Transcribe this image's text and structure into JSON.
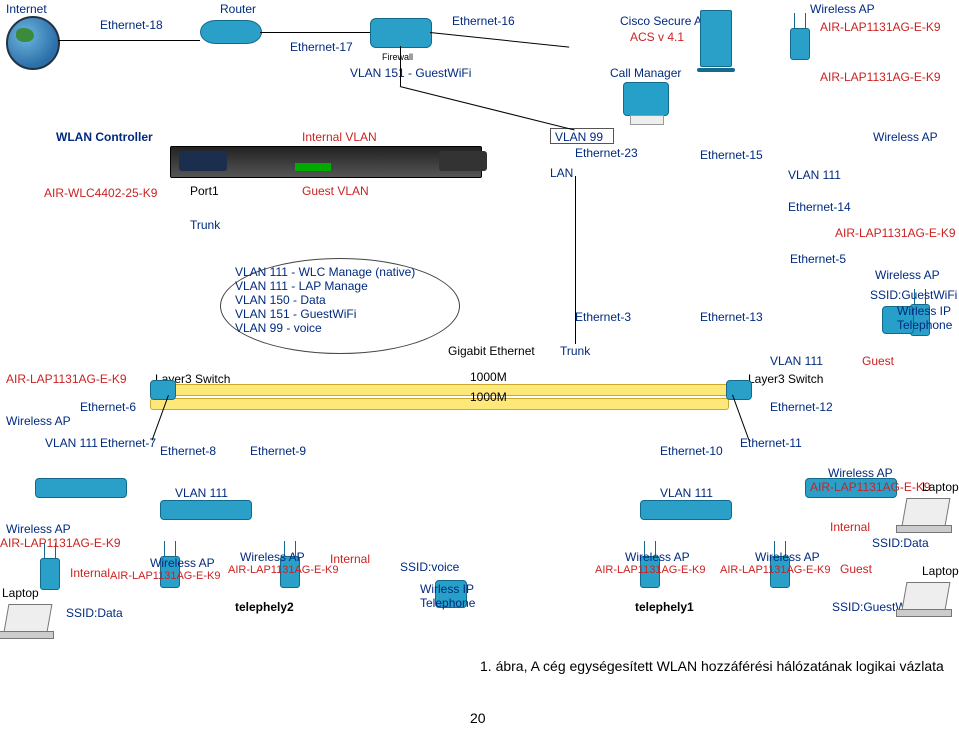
{
  "top": {
    "internet": "Internet",
    "eth18": "Ethernet-18",
    "router": "Router",
    "eth17": "Ethernet-17",
    "eth16": "Ethernet-16",
    "firewall": "Firewall",
    "vlan151": "VLAN 151 - GuestWiFi",
    "acs_title": "Cisco Secure ACS",
    "acs_ver": "ACS v 4.1",
    "callmgr": "Call Manager",
    "wap": "Wireless AP",
    "apmodel1": "AIR-LAP1131AG-E-K9",
    "apmodel2": "AIR-LAP1131AG-E-K9"
  },
  "wlc": {
    "title": "WLAN Controller",
    "model": "AIR-WLC4402-25-K9",
    "port1": "Port1",
    "ivlan": "Internal VLAN",
    "gvlan": "Guest VLAN"
  },
  "lan": {
    "vlan99": "VLAN 99",
    "eth23": "Ethernet-23",
    "lan": "LAN",
    "eth15": "Ethernet-15",
    "vlan111": "VLAN 111",
    "wap": "Wireless AP",
    "eth14": "Ethernet-14",
    "apmodel": "AIR-LAP1131AG-E-K9",
    "eth5": "Ethernet-5",
    "trunk": "Trunk"
  },
  "callout": {
    "l1": "VLAN 111 - WLC Manage (native)",
    "l2": "VLAN 111 - LAP Manage",
    "l3": "VLAN 150 - Data",
    "l4": "VLAN 151 - GuestWiFi",
    "l5": "VLAN 99 - voice"
  },
  "mid": {
    "ge": "Gigabit Ethernet",
    "eth3": "Ethernet-3",
    "trunk": "Trunk",
    "eth13": "Ethernet-13",
    "vlan111": "VLAN 111",
    "wap": "Wireless AP",
    "ssid_guestwifi": "SSID:GuestWiFi",
    "wirless_ip": "Wirless IP",
    "telephone": "Telephone",
    "guest": "Guest"
  },
  "left": {
    "apmodel": "AIR-LAP1131AG-E-K9",
    "l3sw_l": "Layer3 Switch",
    "l3sw_r": "Layer3 Switch",
    "m1": "1000M",
    "m2": "1000M",
    "eth6": "Ethernet-6",
    "wap": "Wireless AP",
    "vlan111": "VLAN 111",
    "eth7": "Ethernet-7",
    "eth8": "Ethernet-8",
    "eth9": "Ethernet-9",
    "eth10": "Ethernet-10",
    "eth11": "Ethernet-11",
    "eth12": "Ethernet-12"
  },
  "bottom": {
    "vlan111_l": "VLAN 111",
    "vlan111_r": "VLAN 111",
    "wap_a": "Wireless AP",
    "ap_a": "AIR-LAP1131AG-E-K9",
    "internal_a": "Internal",
    "laptop_a": "Laptop",
    "ssid_data_a": "SSID:Data",
    "wap_b": "Wireless AP",
    "ap_b": "AIR-LAP1131AG-E-K9",
    "wap_c": "Wireless AP",
    "ap_c": "AIR-LAP1131AG-E-K9",
    "internal_c": "Internal",
    "tel2": "telephely2",
    "ssid_voice": "SSID:voice",
    "wirless_ip": "Wirless IP",
    "telephone": "Telephone",
    "wap_d": "Wireless AP",
    "ap_d": "AIR-LAP1131AG-E-K9",
    "wap_e": "Wireless AP",
    "ap_e": "AIR-LAP1131AG-E-K9",
    "guest_e": "Guest",
    "tel1": "telephely1",
    "wap_f": "Wireless AP",
    "ap_f": "AIR-LAP1131AG-E-K9",
    "laptop_f": "Laptop",
    "internal_f": "Internal",
    "ssid_data_f": "SSID:Data",
    "ssid_guestwifi": "SSID:GuestWiFi",
    "laptop_g": "Laptop"
  },
  "caption": "1. ábra, A cég egységesített WLAN hozzáférési hálózatának logikai vázlata",
  "pagenum": "20"
}
